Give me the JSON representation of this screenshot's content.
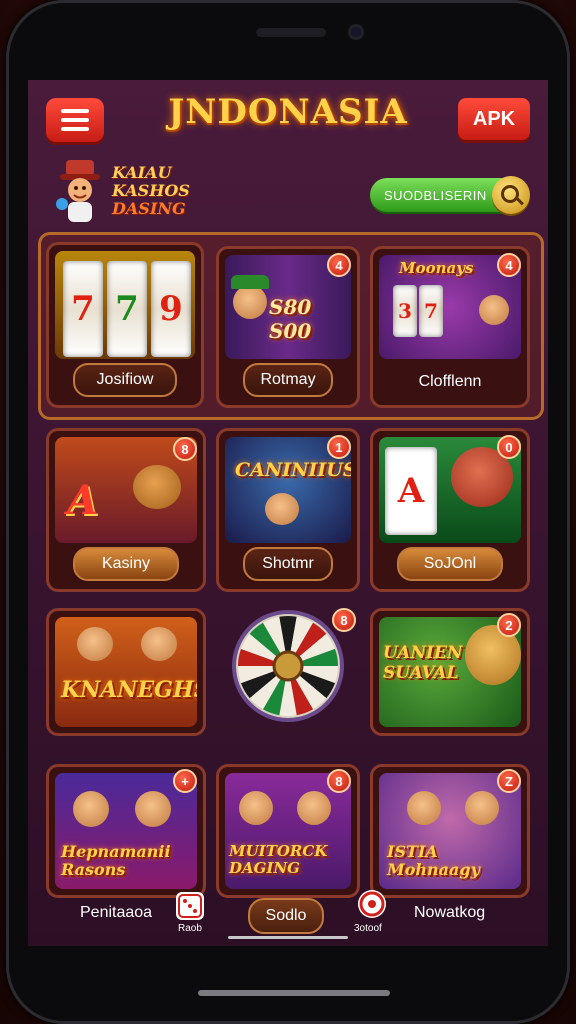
{
  "header": {
    "title": "JNDONASIA",
    "apk_label": "APK",
    "logo_lines": [
      "KAIAU",
      "KASHOS",
      "DASING"
    ],
    "search_text": "SUODBLISERIN"
  },
  "cards": [
    {
      "label": "Josifiow",
      "badge": ""
    },
    {
      "label": "Rotmay",
      "badge": "4",
      "art_text": "S80 S00"
    },
    {
      "label": "Clofflenn",
      "badge": "4",
      "art_text": "Moonays"
    },
    {
      "label": "Kasiny",
      "badge": "8"
    },
    {
      "label": "Shotmr",
      "badge": "1",
      "art_text": "CANINIIUS"
    },
    {
      "label": "SoJOnl",
      "badge": "0"
    },
    {
      "label": "",
      "badge": "",
      "art_text": "KNANEGHS"
    },
    {
      "label": "",
      "badge": "8"
    },
    {
      "label": "",
      "badge": "2",
      "art_text": "UANIEN SUAVAL"
    },
    {
      "label": "",
      "badge": "+",
      "art_text": "Hepnamanii Rasons"
    },
    {
      "label": "",
      "badge": "8",
      "art_text": "MUITORCK DAGING"
    },
    {
      "label": "",
      "badge": "Z",
      "art_text": "ISTIA Mohnaagy"
    }
  ],
  "footer": {
    "left_label": "Penitaaoa",
    "center_label": "Sodlo",
    "right_label": "Nowatkog",
    "left_icon_label": "Raob",
    "right_icon_label": "3otoof"
  },
  "colors": {
    "accent_red": "#d8261a",
    "gold": "#ffd24a",
    "green": "#3fb421"
  }
}
